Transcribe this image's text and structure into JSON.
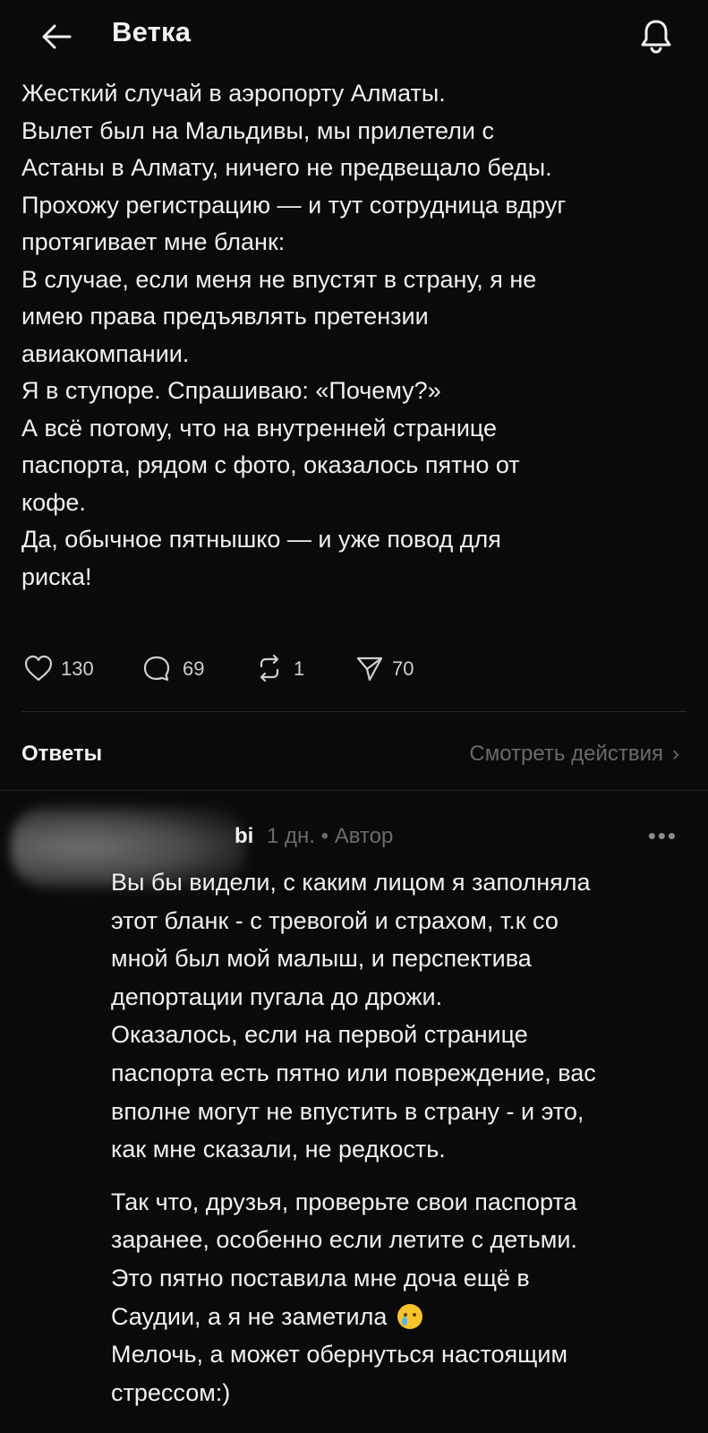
{
  "header": {
    "title": "Ветка",
    "back_icon": "arrow-left-icon",
    "bell_icon": "bell-icon"
  },
  "post": {
    "lines": [
      "Жесткий случай в аэропорту Алматы.",
      "Вылет был на Мальдивы, мы прилетели с",
      "Астаны в Алмату, ничего не предвещало беды.",
      "Прохожу регистрацию — и тут сотрудница вдруг",
      "протягивает мне бланк:",
      "В случае, если меня не впустят в страну, я не",
      "имею права предъявлять претензии",
      "авиакомпании.",
      "Я в ступоре. Спрашиваю: «Почему?»",
      "А всё потому, что на внутренней странице",
      "паспорта, рядом с фото, оказалось пятно от",
      "кофе.",
      "Да, обычное пятнышко — и уже повод для",
      "риска!"
    ]
  },
  "actions": {
    "likes": "130",
    "comments": "69",
    "reposts": "1",
    "shares": "70"
  },
  "replies_section": {
    "title": "Ответы",
    "view_activity": "Смотреть действия",
    "chevron": "›"
  },
  "reply": {
    "name": "bi",
    "time": "1 дн.",
    "separator": "•",
    "author_badge": "Автор",
    "more": "•••",
    "lines": [
      "Вы бы видели, с каким лицом я заполняла",
      "этот бланк - с тревогой и страхом, т.к со",
      "мной был мой малыш, и перспектива",
      "депортации пугала до дрожи.",
      "Оказалось, если на первой странице",
      "паспорта есть пятно или повреждение, вас",
      "вполне могут не впустить в страну - и это,",
      "как мне сказали, не редкость."
    ],
    "lines2": [
      "Так что, друзья, проверьте свои паспорта",
      "заранее, особенно если летите с детьми.",
      "Это пятно поставила мне доча ещё в"
    ],
    "line_emoji": "Саудии, а я не заметила",
    "emoji": "crying-face-icon",
    "lines3": [
      "Мелочь, а может обернуться настоящим",
      "стрессом:)"
    ]
  }
}
